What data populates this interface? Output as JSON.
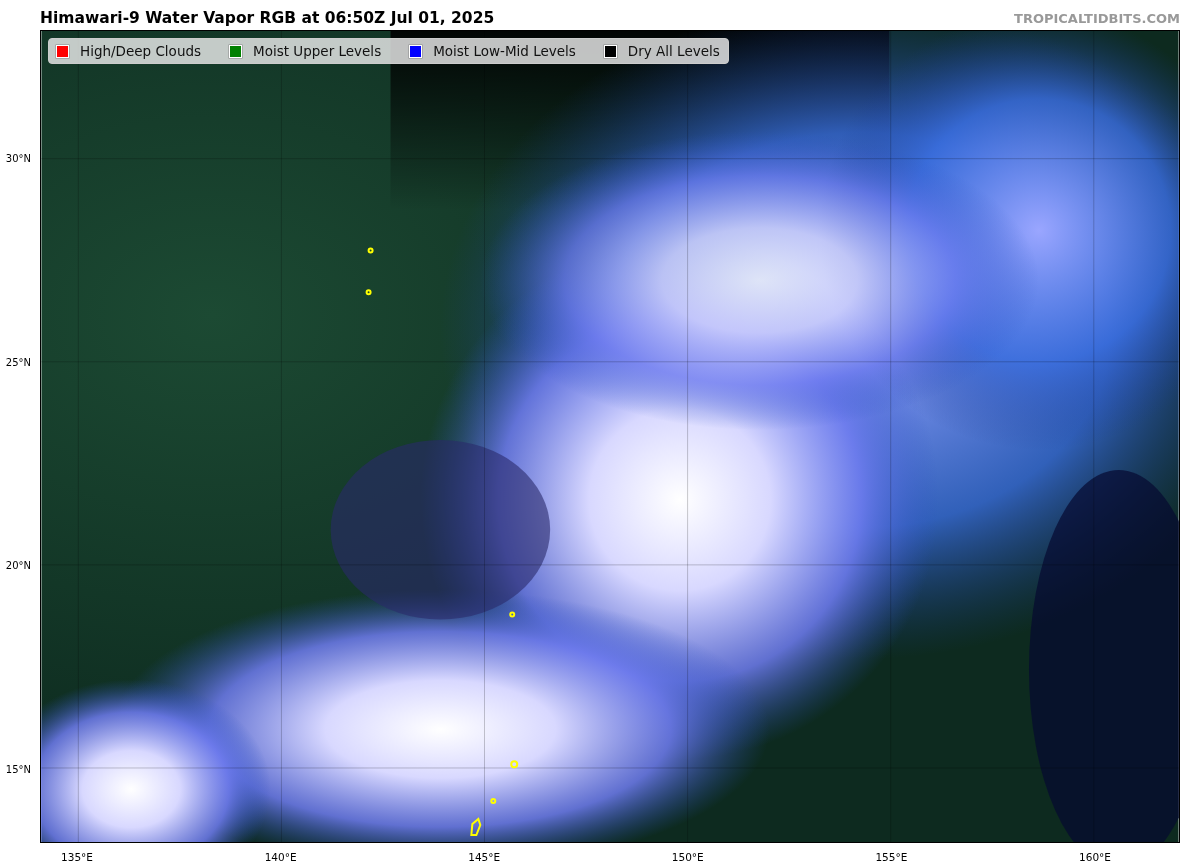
{
  "title": "Himawari-9 Water Vapor RGB at 06:50Z Jul 01, 2025",
  "site_credit": "TROPICALTIDBITS.COM",
  "legend": [
    {
      "label": "High/Deep Clouds",
      "color": "#ff0000"
    },
    {
      "label": "Moist Upper Levels",
      "color": "#008000"
    },
    {
      "label": "Moist Low-Mid Levels",
      "color": "#0000ff"
    },
    {
      "label": "Dry All Levels",
      "color": "#000000"
    }
  ],
  "y_axis_labels": [
    "30°N",
    "25°N",
    "20°N",
    "15°N"
  ],
  "x_axis_labels": [
    "135°E",
    "140°E",
    "145°E",
    "150°E",
    "155°E",
    "160°E"
  ]
}
